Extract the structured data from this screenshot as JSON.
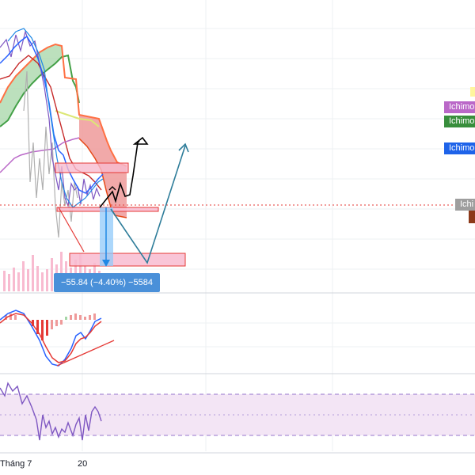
{
  "chart_data": {
    "type": "line",
    "panes": [
      "price-ichimoku",
      "macd",
      "rsi"
    ],
    "x_tick_labels": [
      "Tháng 7",
      "20"
    ],
    "measure_label": "−55.84 (−4.40%) −5584",
    "ichimoku_tags": [
      "Ichimo",
      "Ichimo",
      "Ichimo",
      "Ichi"
    ],
    "colors": {
      "tenkan": "#2962ff",
      "kijun": "#b71c1c",
      "span_a": "#43a047",
      "span_b": "#ff7043",
      "chikou": "#9c27b0",
      "cloud_bull": "#66bb6a",
      "cloud_bear": "#ef5350",
      "rsi": "#7e57c2",
      "rsi_band": "#f3e5f5",
      "measure": "#4a90d9"
    }
  }
}
